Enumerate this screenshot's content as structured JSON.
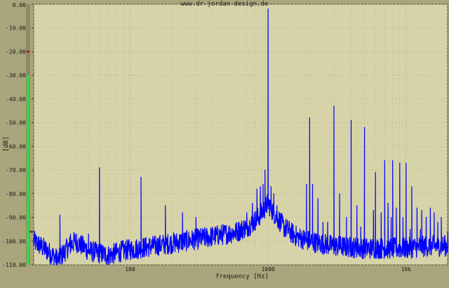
{
  "header": {
    "watermark": "www.dr-jordan-design.de"
  },
  "colors": {
    "frame": "#a9a57c",
    "plot_bg": "#d6d3a9",
    "grid": "#b9b690",
    "trace": "#0000ff",
    "level_bar": "#3fd23f",
    "marker": "#c01818"
  },
  "level_meter": {
    "fill_to_db": -30,
    "marker_db": -20,
    "pointer_db": -96
  },
  "chart_data": {
    "type": "line",
    "title": "",
    "xlabel": "frequency [Hz]",
    "ylabel": "[dB]",
    "x_scale": "log",
    "xlim": [
      20,
      20000
    ],
    "ylim": [
      -110,
      0
    ],
    "grid": true,
    "y_ticks": [
      "0.00",
      "-10.00",
      "-20.00",
      "-30.00",
      "-40.00",
      "-50.00",
      "-60.00",
      "-70.00",
      "-80.00",
      "-90.00",
      "-100.00",
      "-110.00"
    ],
    "x_ticks": [
      {
        "value": 100,
        "label": "100"
      },
      {
        "value": 1000,
        "label": "1000"
      },
      {
        "value": 10000,
        "label": "10k"
      }
    ],
    "noise_floor": [
      [
        20,
        -100
      ],
      [
        25,
        -104
      ],
      [
        30,
        -108
      ],
      [
        35,
        -103
      ],
      [
        40,
        -100
      ],
      [
        50,
        -104
      ],
      [
        70,
        -106
      ],
      [
        90,
        -104
      ],
      [
        150,
        -102
      ],
      [
        250,
        -100
      ],
      [
        400,
        -98
      ],
      [
        600,
        -96
      ],
      [
        750,
        -93
      ],
      [
        850,
        -90
      ],
      [
        950,
        -86
      ],
      [
        1000,
        -84
      ],
      [
        1100,
        -88
      ],
      [
        1300,
        -94
      ],
      [
        1600,
        -98
      ],
      [
        2000,
        -100
      ],
      [
        3000,
        -102
      ],
      [
        5000,
        -103
      ],
      [
        10000,
        -103
      ],
      [
        15000,
        -102
      ],
      [
        20000,
        -102
      ]
    ],
    "peaks": [
      [
        31,
        -89
      ],
      [
        37,
        -97
      ],
      [
        50,
        -97
      ],
      [
        60,
        -69
      ],
      [
        120,
        -73
      ],
      [
        180,
        -85
      ],
      [
        240,
        -88
      ],
      [
        300,
        -90
      ],
      [
        360,
        -95
      ],
      [
        700,
        -88
      ],
      [
        770,
        -84
      ],
      [
        830,
        -78
      ],
      [
        880,
        -77
      ],
      [
        920,
        -76
      ],
      [
        950,
        -70
      ],
      [
        1000,
        -2
      ],
      [
        1050,
        -77
      ],
      [
        1100,
        -80
      ],
      [
        1160,
        -85
      ],
      [
        1220,
        -90
      ],
      [
        1500,
        -95
      ],
      [
        1900,
        -76
      ],
      [
        2000,
        -48
      ],
      [
        2100,
        -76
      ],
      [
        2300,
        -82
      ],
      [
        2500,
        -92
      ],
      [
        2700,
        -92
      ],
      [
        3000,
        -43
      ],
      [
        3300,
        -80
      ],
      [
        3700,
        -90
      ],
      [
        4000,
        -49
      ],
      [
        4400,
        -85
      ],
      [
        4700,
        -94
      ],
      [
        5000,
        -52
      ],
      [
        5800,
        -87
      ],
      [
        6000,
        -71
      ],
      [
        6600,
        -88
      ],
      [
        7000,
        -66
      ],
      [
        7400,
        -84
      ],
      [
        7800,
        -90
      ],
      [
        8000,
        -66
      ],
      [
        8500,
        -86
      ],
      [
        9000,
        -67
      ],
      [
        9500,
        -90
      ],
      [
        10000,
        -67
      ],
      [
        10700,
        -95
      ],
      [
        11000,
        -77
      ],
      [
        12000,
        -86
      ],
      [
        12700,
        -95
      ],
      [
        13000,
        -87
      ],
      [
        14000,
        -90
      ],
      [
        15000,
        -86
      ],
      [
        16000,
        -88
      ],
      [
        17000,
        -92
      ],
      [
        18000,
        -90
      ],
      [
        19000,
        -98
      ],
      [
        20000,
        -96
      ]
    ]
  }
}
